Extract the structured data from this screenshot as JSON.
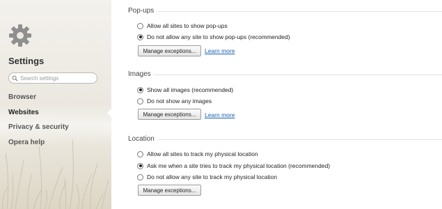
{
  "sidebar": {
    "title": "Settings",
    "search_placeholder": "Search settings",
    "items": [
      {
        "label": "Browser"
      },
      {
        "label": "Websites"
      },
      {
        "label": "Privacy & security"
      },
      {
        "label": "Opera help"
      }
    ],
    "active_item": "Websites"
  },
  "sections": {
    "popups": {
      "title": "Pop-ups",
      "options": [
        {
          "label": "Allow all sites to show pop-ups",
          "checked": false
        },
        {
          "label": "Do not allow any site to show pop-ups (recommended)",
          "checked": true
        }
      ],
      "button": "Manage exceptions...",
      "link": "Learn more"
    },
    "images": {
      "title": "Images",
      "options": [
        {
          "label": "Show all images (recommended)",
          "checked": true
        },
        {
          "label": "Do not show any images",
          "checked": false
        }
      ],
      "button": "Manage exceptions...",
      "link": "Learn more"
    },
    "location": {
      "title": "Location",
      "options": [
        {
          "label": "Allow all sites to track my physical location",
          "checked": false
        },
        {
          "label": "Ask me when a site tries to track my physical location (recommended)",
          "checked": true
        },
        {
          "label": "Do not allow any site to track my physical location",
          "checked": false
        }
      ],
      "button": "Manage exceptions..."
    }
  },
  "colors": {
    "link": "#1a5fb4",
    "sidebar_bg": "#ece9e2"
  }
}
